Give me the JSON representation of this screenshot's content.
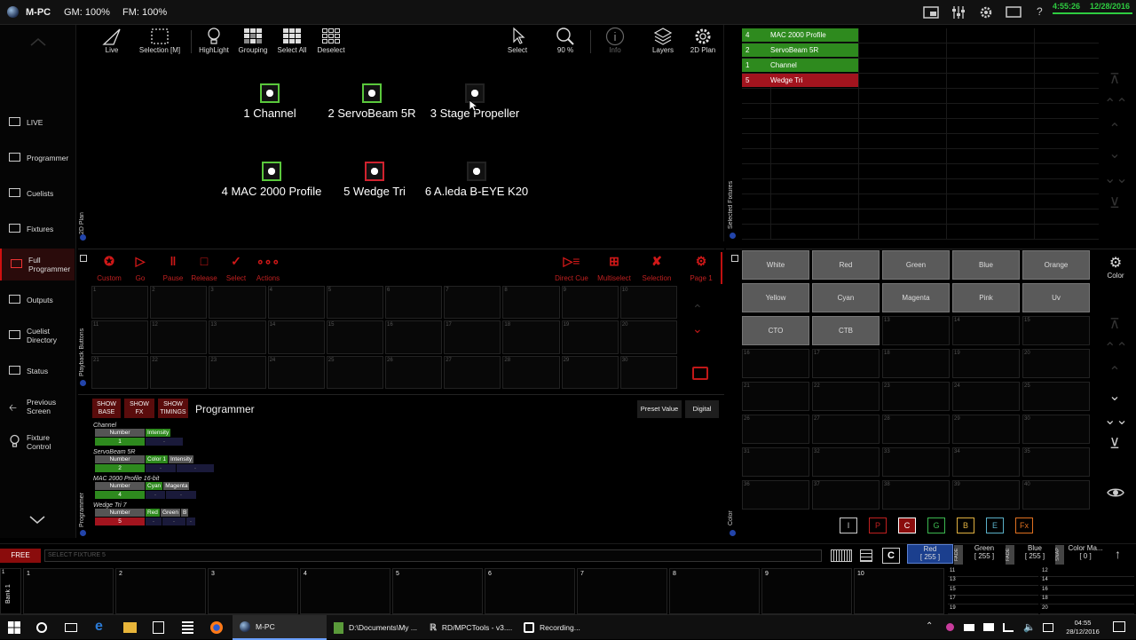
{
  "app": {
    "title": "M-PC",
    "gm": "GM: 100%",
    "fm": "FM: 100%",
    "time": "4:55:26",
    "date": "12/28/2016"
  },
  "sidebar": {
    "items": [
      {
        "label": "LIVE"
      },
      {
        "label": "Programmer"
      },
      {
        "label": "Cuelists"
      },
      {
        "label": "Fixtures"
      },
      {
        "label": "Full Programmer",
        "active": true
      },
      {
        "label": "Outputs"
      },
      {
        "label": "Cuelist Directory"
      },
      {
        "label": "Status"
      },
      {
        "label": "Previous Screen"
      },
      {
        "label": "Fixture Control"
      }
    ]
  },
  "plan": {
    "tab": "2D Plan",
    "tools": [
      {
        "label": "Live",
        "icon": "live-triangle-icon"
      },
      {
        "label": "Selection [M]",
        "icon": "selection-box-icon"
      },
      {
        "label": "HighLight",
        "icon": "bulb-icon"
      },
      {
        "label": "Grouping",
        "icon": "grouping-icon"
      },
      {
        "label": "Select All",
        "icon": "select-all-icon"
      },
      {
        "label": "Deselect",
        "icon": "deselect-icon"
      },
      {
        "label": "Select",
        "icon": "cursor-icon"
      },
      {
        "label": "90 %",
        "icon": "zoom-icon"
      },
      {
        "label": "Info",
        "icon": "info-icon"
      },
      {
        "label": "Layers",
        "icon": "layers-icon"
      },
      {
        "label": "2D Plan",
        "icon": "gear-icon"
      }
    ],
    "fixtures": [
      {
        "label": "1 Channel",
        "color": "#5ac83c"
      },
      {
        "label": "2 ServoBeam 5R",
        "color": "#5ac83c"
      },
      {
        "label": "3 Stage Propeller",
        "color": "#222222"
      },
      {
        "label": "4 MAC 2000 Profile",
        "color": "#5ac83c"
      },
      {
        "label": "5 Wedge Tri",
        "color": "#d0222e"
      },
      {
        "label": "6 A.leda B-EYE K20",
        "color": "#222222"
      }
    ]
  },
  "selected": {
    "tab": "Selected Fixtures",
    "rows": [
      {
        "num": "4",
        "name": "MAC 2000 Profile",
        "color": "#2e8a1e"
      },
      {
        "num": "2",
        "name": "ServoBeam 5R",
        "color": "#2e8a1e"
      },
      {
        "num": "1",
        "name": "Channel",
        "color": "#2e8a1e"
      },
      {
        "num": "5",
        "name": "Wedge Tri",
        "color": "#a2141e"
      }
    ]
  },
  "playback": {
    "tab": "Playback Buttons",
    "left_buttons": [
      "Custom",
      "Go",
      "Pause",
      "Release",
      "Select",
      "Actions"
    ],
    "right_buttons": [
      "Direct Cue",
      "Multiselect",
      "Selection",
      "Page 1"
    ],
    "cells": [
      "1",
      "2",
      "3",
      "4",
      "5",
      "6",
      "7",
      "8",
      "9",
      "10",
      "11",
      "12",
      "13",
      "14",
      "15",
      "16",
      "17",
      "18",
      "19",
      "20",
      "21",
      "22",
      "23",
      "24",
      "25",
      "26",
      "27",
      "28",
      "29",
      "30"
    ]
  },
  "programmer": {
    "tab": "Programmer",
    "title": "Programmer",
    "show_buttons": [
      [
        "SHOW",
        "BASE"
      ],
      [
        "SHOW",
        "FX"
      ],
      [
        "SHOW",
        "TIMINGS"
      ]
    ],
    "preset_value": "Preset Value",
    "digital": "Digital",
    "fixtures": [
      {
        "name": "Channel",
        "number": "1",
        "attrs": [
          "Intensity"
        ],
        "color": "#2e8a1e"
      },
      {
        "name": "ServoBeam 5R",
        "number": "2",
        "attrs": [
          "Color 1",
          "Intensity"
        ],
        "color": "#2e8a1e"
      },
      {
        "name": "MAC 2000 Profile 16-bit",
        "number": "4",
        "attrs": [
          "Cyan",
          "Magenta"
        ],
        "color": "#2e8a1e"
      },
      {
        "name": "Wedge Tri 7",
        "number": "5",
        "attrs": [
          "Red",
          "Green",
          "B"
        ],
        "color": "#a2141e"
      }
    ],
    "number_label": "Number",
    "dash": "-"
  },
  "color": {
    "tab": "Color",
    "side_label": "Color",
    "presets": [
      "White",
      "Red",
      "Green",
      "Blue",
      "Orange",
      "Yellow",
      "Cyan",
      "Magenta",
      "Pink",
      "Uv",
      "CTO",
      "CTB"
    ],
    "empty_cells": [
      "13",
      "14",
      "15",
      "16",
      "17",
      "18",
      "19",
      "20",
      "21",
      "22",
      "23",
      "24",
      "25",
      "26",
      "27",
      "28",
      "29",
      "30",
      "31",
      "32",
      "33",
      "34",
      "35",
      "36",
      "37",
      "38",
      "39",
      "40"
    ],
    "groups": [
      {
        "label": "I",
        "color": "#cccccc"
      },
      {
        "label": "P",
        "color": "#c02020"
      },
      {
        "label": "C",
        "color": "#ffffff",
        "active": true
      },
      {
        "label": "G",
        "color": "#3cb850"
      },
      {
        "label": "B",
        "color": "#e0b040"
      },
      {
        "label": "E",
        "color": "#5ab0c8"
      },
      {
        "label": "Fx",
        "color": "#e07020"
      }
    ]
  },
  "command": {
    "free": "FREE",
    "placeholder": "SELECT FIXTURE 5",
    "c_button": "C"
  },
  "faders": [
    {
      "name": "Red",
      "value": "[ 255 ]",
      "active": true
    },
    {
      "name": "Green",
      "value": "[ 255 ]"
    },
    {
      "name": "Blue",
      "value": "[ 255 ]"
    },
    {
      "name": "Color Ma...",
      "value": "[ 0 ]"
    }
  ],
  "fader_tags": [
    "FADE",
    "FADE",
    "FADE",
    "SNAP"
  ],
  "bank": {
    "label": "Bank 1",
    "slots": [
      "1",
      "2",
      "3",
      "4",
      "5",
      "6",
      "7",
      "8",
      "9",
      "10"
    ],
    "mini_left": [
      "11",
      "13",
      "15",
      "17",
      "19"
    ],
    "mini_right": [
      "12",
      "14",
      "16",
      "18",
      "20"
    ]
  },
  "taskbar": {
    "tasks": [
      {
        "label": "M-PC",
        "active": true
      },
      {
        "label": "D:\\Documents\\My ..."
      },
      {
        "label": "RD/MPCTools - v3...."
      },
      {
        "label": "Recording..."
      }
    ],
    "time": "04:55",
    "date": "28/12/2016"
  }
}
